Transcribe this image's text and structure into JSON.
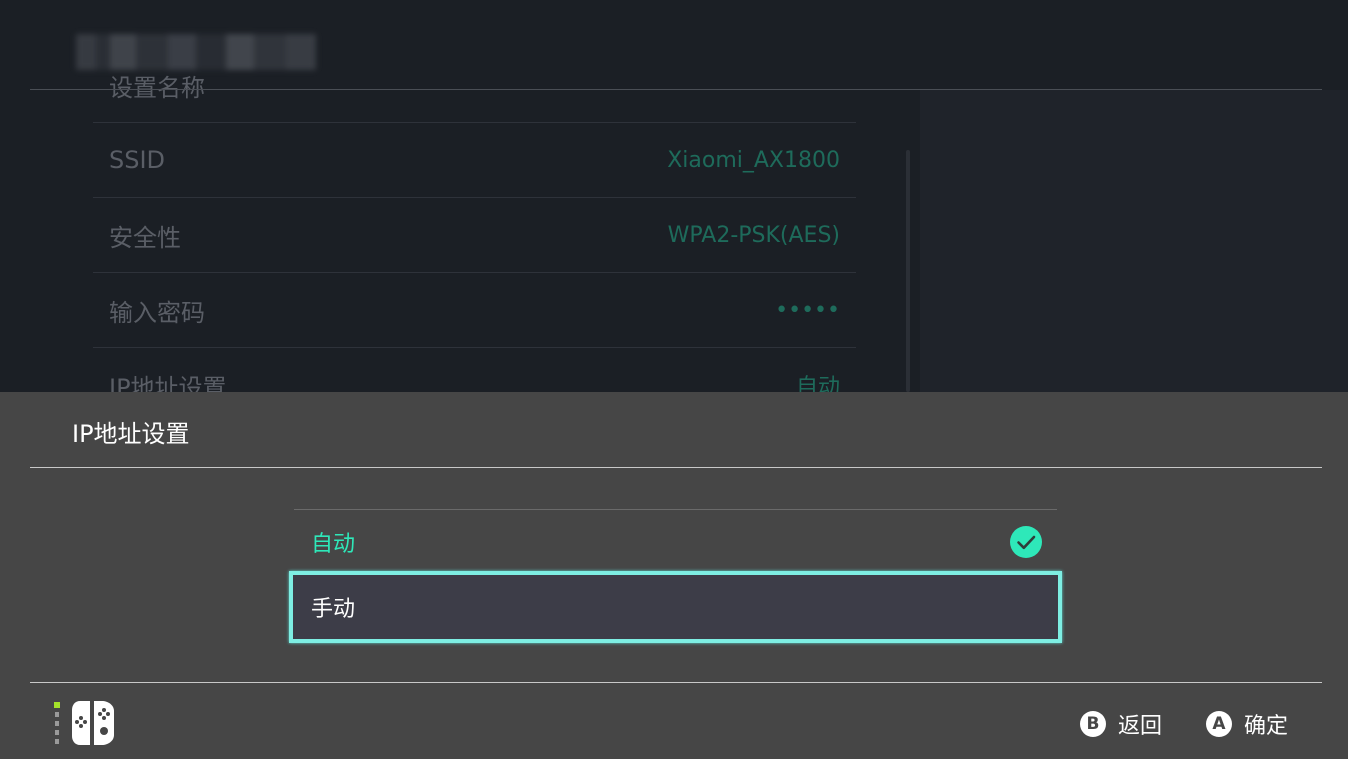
{
  "background": {
    "rows": [
      {
        "label": "设置名称",
        "value": ""
      },
      {
        "label": "SSID",
        "value": "Xiaomi_AX1800"
      },
      {
        "label": "安全性",
        "value": "WPA2-PSK(AES)"
      },
      {
        "label": "输入密码",
        "value": "•••••"
      },
      {
        "label": "IP地址设置",
        "value": "自动"
      }
    ]
  },
  "modal": {
    "title": "IP地址设置",
    "options": [
      {
        "label": "自动",
        "selected": true
      },
      {
        "label": "手动",
        "focused": true
      }
    ]
  },
  "footer": {
    "back": {
      "button": "B",
      "label": "返回"
    },
    "ok": {
      "button": "A",
      "label": "确定"
    }
  },
  "colors": {
    "accent": "#2ee8b9",
    "focus_border": "#7eeee3",
    "modal_bg": "#464646",
    "page_bg": "#1b1f25",
    "joycon_indicator": "#a4e22a"
  },
  "icons": {
    "check": "check-circle-icon",
    "controller": "joycon-controller-icon"
  }
}
